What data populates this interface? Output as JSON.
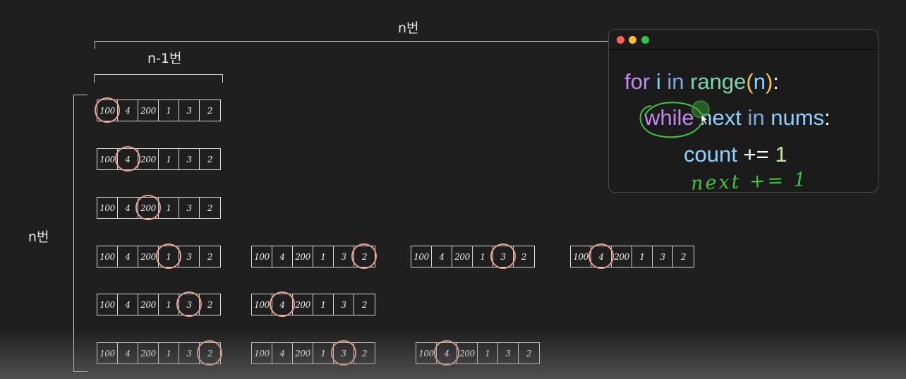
{
  "labels": {
    "n_top": "n번",
    "n_minus_1": "n-1번",
    "n_left": "n번"
  },
  "code": {
    "line1": {
      "kw": "for",
      "var": "i",
      "op": "in",
      "fn": "range",
      "open": "(",
      "arg": "n",
      "close": ")",
      "colon": ":"
    },
    "line2": {
      "kw": "while",
      "var": "next",
      "op": "in",
      "var2": "nums",
      "colon": ":"
    },
    "line3": {
      "var": "count",
      "op": "+=",
      "num": "1"
    },
    "annotation": "next += 1"
  },
  "colors": {
    "window_dots": [
      "#ff5f57",
      "#febc2e",
      "#28c840"
    ],
    "highlight_ring": "#e7a08e",
    "annotation_green": "#3fc63f"
  },
  "array_values": [
    "100",
    "4",
    "200",
    "1",
    "3",
    "2"
  ],
  "rows": [
    {
      "arrays": [
        {
          "highlight": 0
        }
      ]
    },
    {
      "arrays": [
        {
          "highlight": 1
        }
      ]
    },
    {
      "arrays": [
        {
          "highlight": 2
        }
      ]
    },
    {
      "arrays": [
        {
          "highlight": 3
        },
        {
          "highlight": 5
        },
        {
          "highlight": 4
        },
        {
          "highlight": 1
        }
      ]
    },
    {
      "arrays": [
        {
          "highlight": 4
        },
        {
          "highlight": 1
        }
      ]
    },
    {
      "arrays": [
        {
          "highlight": 5
        },
        {
          "highlight": 4
        },
        {
          "highlight": 1
        }
      ]
    }
  ]
}
